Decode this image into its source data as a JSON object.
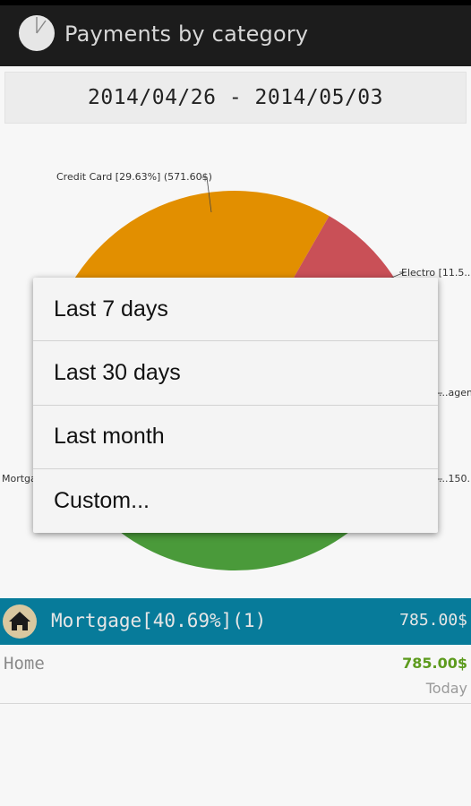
{
  "header": {
    "title": "Payments by category",
    "icon": "pie-chart-icon"
  },
  "date_range": {
    "text": "2014/04/26 - 2014/05/03"
  },
  "chart_data": {
    "type": "pie",
    "slices": [
      {
        "label": "Credit Card [29.63%] (571.60$)",
        "percent": 29.63,
        "value": 571.6,
        "color": "#e28f00"
      },
      {
        "label": "Electro [11.5...",
        "percent": 11.5,
        "color": "#c95057"
      },
      {
        "label": "...agem...",
        "percent": 10.0,
        "color": "#b54a8f"
      },
      {
        "label": "...150....",
        "percent": 8.18,
        "color": "#3b7bc4"
      },
      {
        "label": "Mortga...",
        "percent": 40.69,
        "value": 785.0,
        "color": "#4a9a3a"
      }
    ]
  },
  "popup_menu": {
    "items": [
      {
        "label": "Last 7 days"
      },
      {
        "label": "Last 30 days"
      },
      {
        "label": "Last month"
      },
      {
        "label": "Custom..."
      }
    ]
  },
  "category": {
    "title": "Mortgage[40.69%](1)",
    "amount": "785.00$",
    "icon": "home-icon",
    "header_color": "#077b9a"
  },
  "rows": [
    {
      "name": "Home",
      "amount": "785.00$",
      "date": "Today",
      "amount_color": "#5d9b1e"
    }
  ]
}
